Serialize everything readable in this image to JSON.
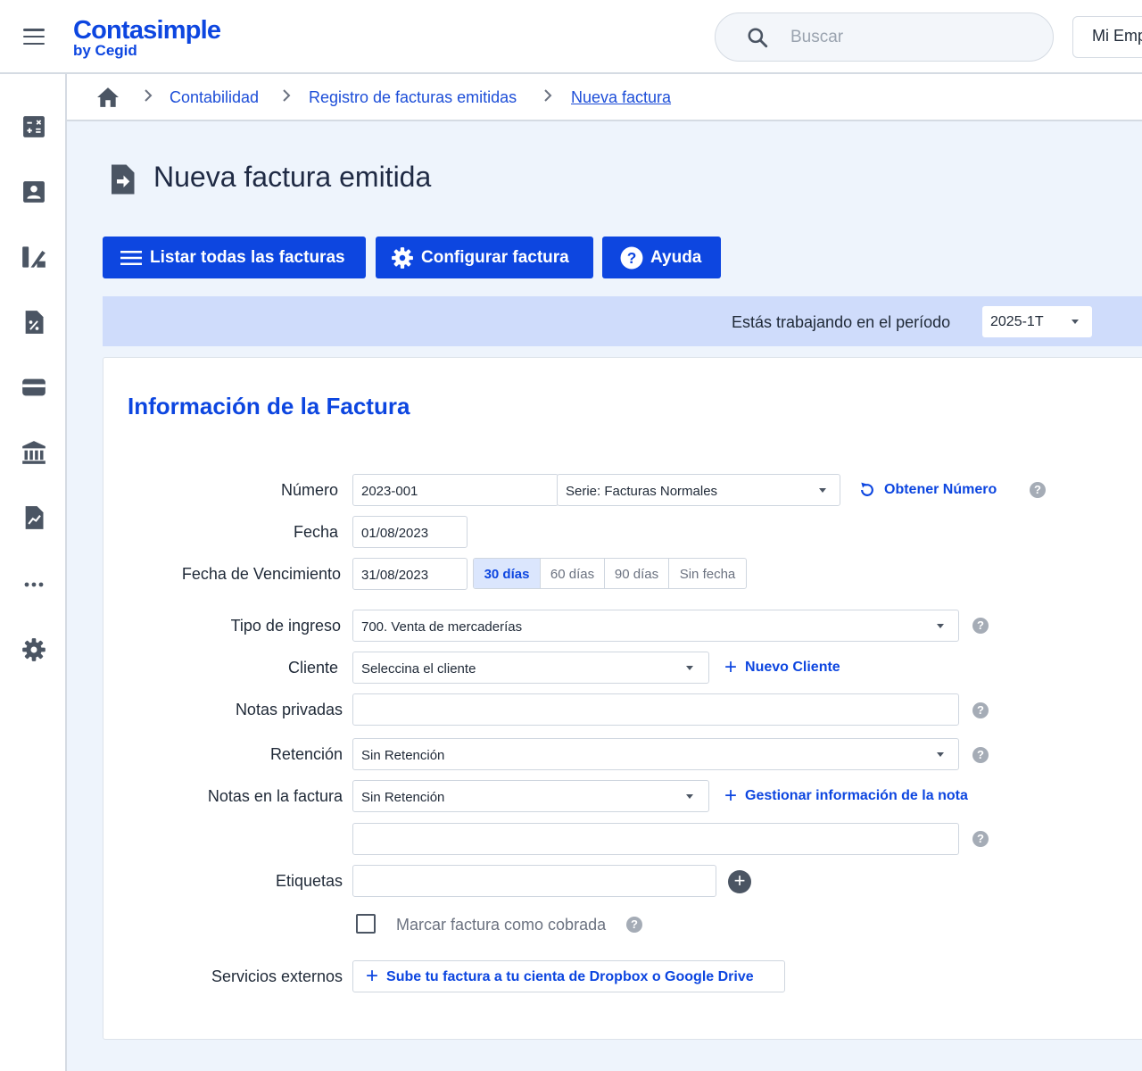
{
  "header": {
    "brand": "Contasimple",
    "brand_sub": "by Cegid",
    "search_placeholder": "Buscar",
    "company_button": "Mi Emp"
  },
  "sidebar": {
    "items": [
      {
        "icon": "calculator-icon"
      },
      {
        "icon": "contact-card-icon"
      },
      {
        "icon": "chart-tools-icon"
      },
      {
        "icon": "tax-document-icon"
      },
      {
        "icon": "wallet-icon"
      },
      {
        "icon": "bank-icon"
      },
      {
        "icon": "report-chart-icon"
      },
      {
        "icon": "more-icon"
      },
      {
        "icon": "gear-icon"
      }
    ]
  },
  "breadcrumb": {
    "items": [
      "Contabilidad",
      "Registro de facturas emitidas",
      "Nueva factura"
    ]
  },
  "page": {
    "title": "Nueva factura emitida"
  },
  "actions": {
    "list_all": "Listar todas las facturas",
    "configure": "Configurar factura",
    "help": "Ayuda"
  },
  "period": {
    "label": "Estás trabajando en el período",
    "value": "2025-1T"
  },
  "form": {
    "title": "Información de la Factura",
    "numero_label": "Número",
    "numero_value": "2023-001",
    "serie_value": "Serie: Facturas Normales",
    "obtener_numero": "Obtener Número",
    "fecha_label": "Fecha",
    "fecha_value": "01/08/2023",
    "vencimiento_label": "Fecha de Vencimiento",
    "vencimiento_value": "31/08/2023",
    "vencimiento_options": [
      "30 días",
      "60 días",
      "90 días",
      "Sin fecha"
    ],
    "vencimiento_selected": "30 días",
    "tipo_ingreso_label": "Tipo de ingreso",
    "tipo_ingreso_value": "700. Venta de mercaderías",
    "cliente_label": "Cliente",
    "cliente_value": "Seleccina el cliente",
    "nuevo_cliente": "Nuevo Cliente",
    "notas_privadas_label": "Notas privadas",
    "notas_privadas_value": "",
    "retencion_label": "Retención",
    "retencion_value": "Sin Retención",
    "notas_factura_label": "Notas en la factura",
    "notas_factura_value": "Sin Retención",
    "gestionar_nota": "Gestionar información de la nota",
    "notas_factura_text": "",
    "etiquetas_label": "Etiquetas",
    "etiquetas_value": "",
    "cobrada_label": "Marcar factura como cobrada",
    "cobrada_checked": false,
    "servicios_label": "Servicios externos",
    "servicios_button": "Sube tu factura a tu cienta de Dropbox o Google Drive"
  },
  "colors": {
    "primary": "#0d46e0",
    "period_bar": "#cfdcfb",
    "page_bg": "#eef4fc"
  }
}
